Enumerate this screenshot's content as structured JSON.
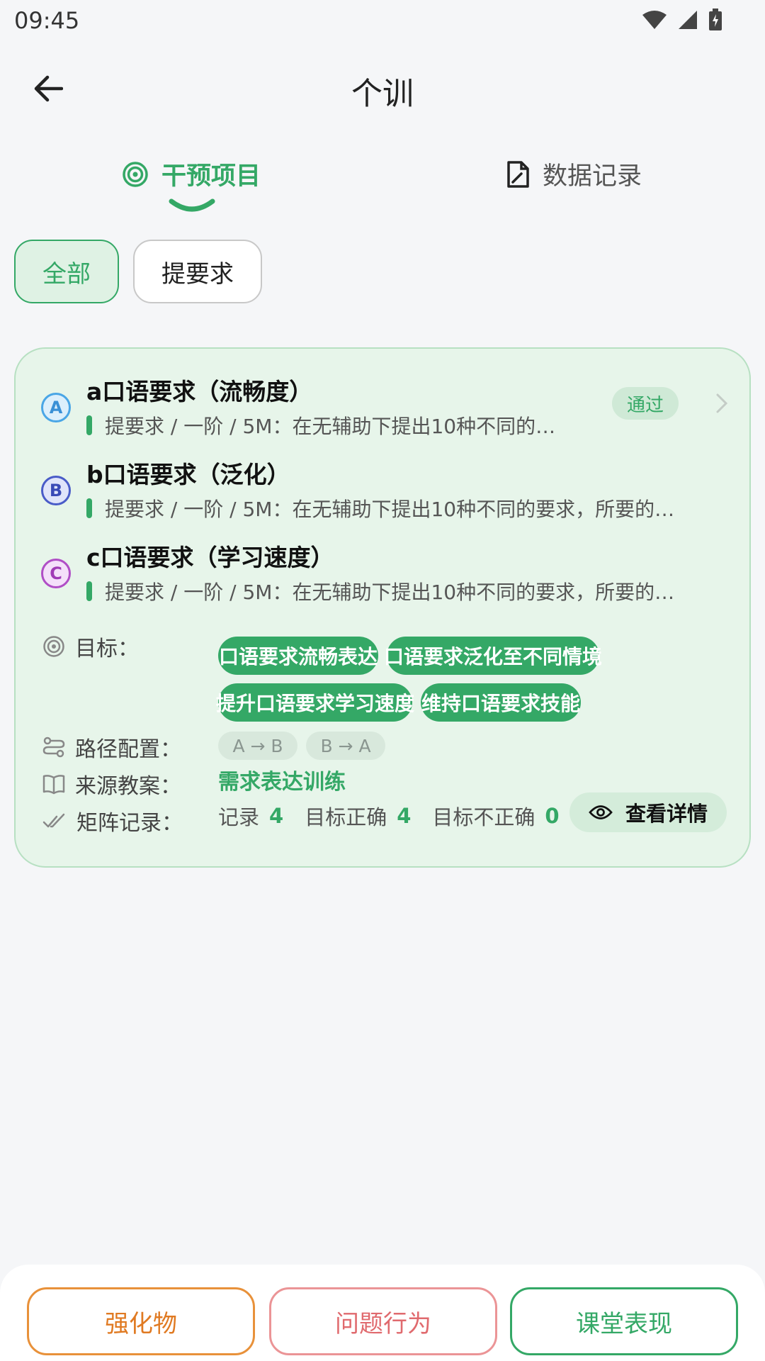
{
  "status_bar": {
    "time": "09:45"
  },
  "header": {
    "title": "个训"
  },
  "tabs": [
    {
      "label": "干预项目"
    },
    {
      "label": "数据记录"
    }
  ],
  "filters": [
    {
      "label": "全部"
    },
    {
      "label": "提要求"
    }
  ],
  "card": {
    "items": [
      {
        "badge": "A",
        "title": "a口语要求（流畅度）",
        "subtitle": "提要求 / 一阶 / 5M：在无辅助下提出10种不同的…"
      },
      {
        "badge": "B",
        "title": "b口语要求（泛化）",
        "subtitle": "提要求 / 一阶 / 5M：在无辅助下提出10种不同的要求，所要的…"
      },
      {
        "badge": "C",
        "title": "c口语要求（学习速度）",
        "subtitle": "提要求 / 一阶 / 5M：在无辅助下提出10种不同的要求，所要的…"
      }
    ],
    "status_badge": "通过",
    "goals_label": "目标：",
    "goals": [
      "口语要求流畅表达",
      "口语要求泛化至不同情境",
      "提升口语要求学习速度",
      "维持口语要求技能"
    ],
    "path_label": "路径配置：",
    "paths": [
      "A → B",
      "B → A"
    ],
    "source_label": "来源教案：",
    "source_value": "需求表达训练",
    "matrix_label": "矩阵记录：",
    "matrix": {
      "records_label": "记录",
      "records_value": "4",
      "correct_label": "目标正确",
      "correct_value": "4",
      "incorrect_label": "目标不正确",
      "incorrect_value": "0"
    },
    "detail_button": "查看详情"
  },
  "bottom_buttons": [
    {
      "label": "强化物"
    },
    {
      "label": "问题行为"
    },
    {
      "label": "课堂表现"
    }
  ],
  "colors": {
    "accent": "#34a866",
    "orange": "#e07a22",
    "red": "#e06a6e"
  }
}
